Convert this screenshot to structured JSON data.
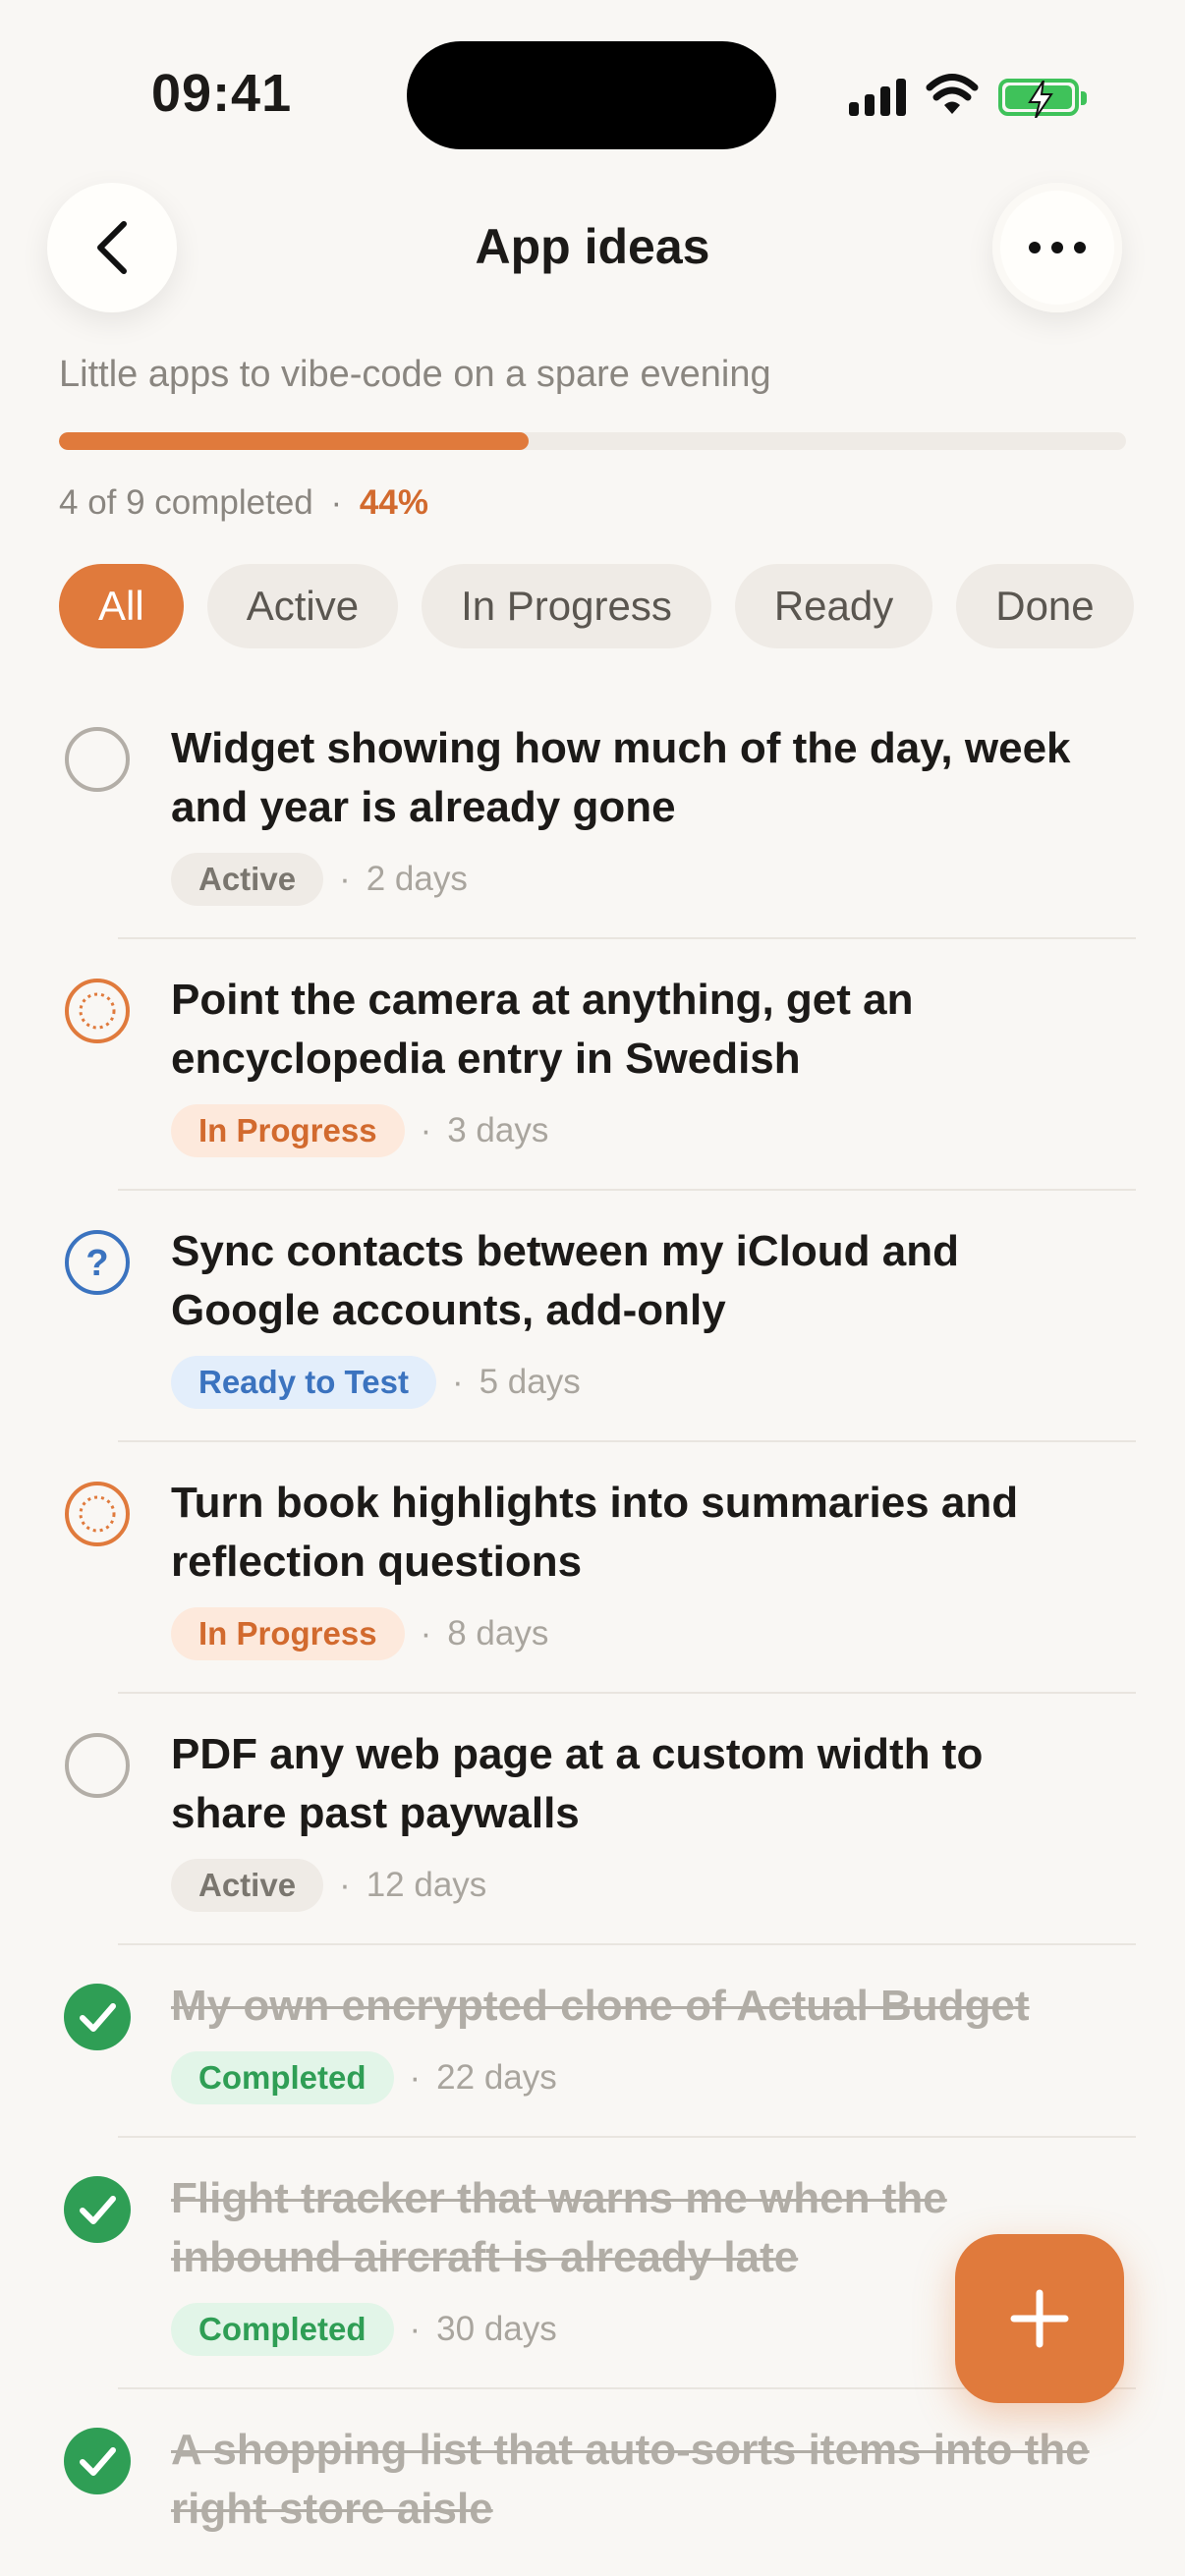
{
  "status": {
    "time": "09:41"
  },
  "header": {
    "title": "App ideas"
  },
  "subtitle": "Little apps to vibe-code on a spare evening",
  "progress": {
    "fraction": 0.44,
    "text": "4 of 9 completed",
    "separator": "·",
    "percent": "44%"
  },
  "filters": [
    "All",
    "Active",
    "In Progress",
    "Ready",
    "Done"
  ],
  "selected_filter": "All",
  "items": [
    {
      "title": "Widget showing how much of the day, week and year is already gone",
      "status": "Active",
      "age": "2 days"
    },
    {
      "title": "Point the camera at anything, get an encyclopedia entry in Swedish",
      "status": "In Progress",
      "age": "3 days"
    },
    {
      "title": "Sync contacts between my iCloud and Google accounts, add-only",
      "status": "Ready to Test",
      "age": "5 days"
    },
    {
      "title": "Turn book highlights into summaries and reflection questions",
      "status": "In Progress",
      "age": "8 days"
    },
    {
      "title": "PDF any web page at a custom width to share past paywalls",
      "status": "Active",
      "age": "12 days"
    },
    {
      "title": "My own encrypted clone of Actual Budget",
      "status": "Completed",
      "age": "22 days"
    },
    {
      "title": "Flight tracker that warns me when the inbound aircraft is already late",
      "status": "Completed",
      "age": "30 days"
    },
    {
      "title": "A shopping list that auto-sorts items into the right store aisle",
      "status": "Completed",
      "age": ""
    }
  ],
  "colors": {
    "accent": "#e07a3c",
    "ready": "#3b73bf",
    "completed": "#2f9e55",
    "background": "#f9f7f4"
  }
}
